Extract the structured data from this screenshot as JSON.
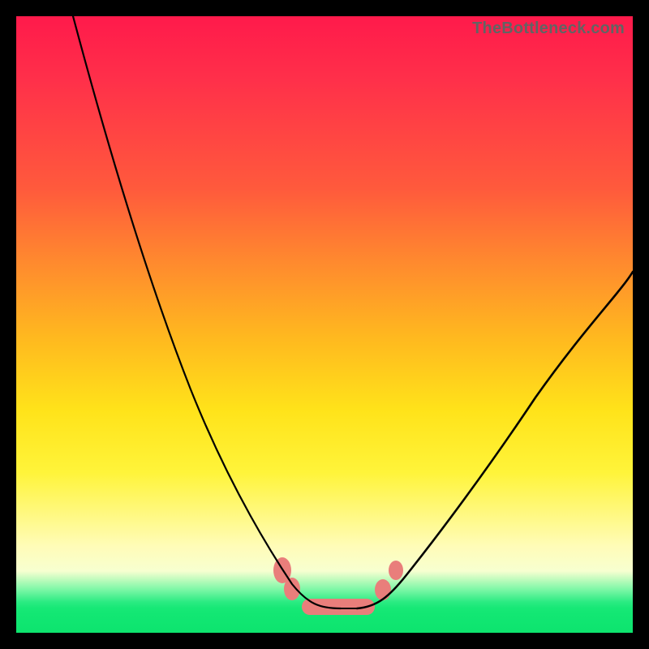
{
  "watermark": "TheBottleneck.com",
  "chart_data": {
    "type": "line",
    "title": "",
    "xlabel": "",
    "ylabel": "",
    "xlim": [
      0,
      100
    ],
    "ylim": [
      0,
      100
    ],
    "series": [
      {
        "name": "left-curve",
        "x": [
          9,
          12,
          16,
          20,
          24,
          28,
          32,
          36,
          40,
          43,
          45,
          47,
          49,
          50
        ],
        "y": [
          100,
          90,
          78,
          66,
          55,
          44,
          34,
          25,
          16,
          10,
          7,
          5,
          4,
          3
        ]
      },
      {
        "name": "right-curve",
        "x": [
          56,
          58,
          60,
          63,
          68,
          74,
          82,
          90,
          98,
          100
        ],
        "y": [
          3,
          4,
          5,
          7,
          12,
          20,
          32,
          44,
          56,
          59
        ]
      }
    ],
    "annotations": [
      {
        "name": "salmon-pill-bottom",
        "type": "pill",
        "x_range": [
          47,
          58
        ],
        "y": 3
      },
      {
        "name": "salmon-blob-left-1",
        "type": "blob",
        "x": 43,
        "y": 10
      },
      {
        "name": "salmon-blob-left-2",
        "type": "blob",
        "x": 45,
        "y": 6
      },
      {
        "name": "salmon-blob-right-1",
        "type": "blob",
        "x": 60,
        "y": 6
      },
      {
        "name": "salmon-blob-right-2",
        "type": "blob",
        "x": 62,
        "y": 9
      }
    ],
    "background_gradient": {
      "orientation": "vertical",
      "stops": [
        {
          "pos": 0.0,
          "color": "#ff1a4b"
        },
        {
          "pos": 0.28,
          "color": "#ff5a3c"
        },
        {
          "pos": 0.52,
          "color": "#ffb81f"
        },
        {
          "pos": 0.74,
          "color": "#fff43a"
        },
        {
          "pos": 0.9,
          "color": "#f7ffd0"
        },
        {
          "pos": 0.95,
          "color": "#2beb82"
        },
        {
          "pos": 1.0,
          "color": "#0de46e"
        }
      ]
    }
  }
}
